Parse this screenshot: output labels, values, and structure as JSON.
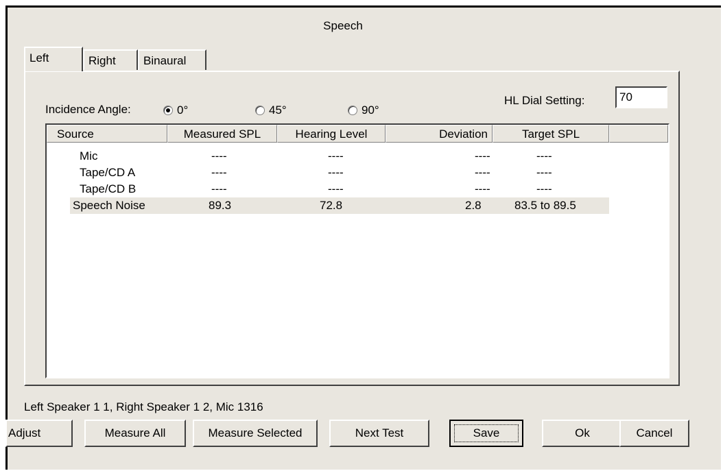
{
  "window": {
    "title": "Speech"
  },
  "tabs": [
    "Left",
    "Right",
    "Binaural"
  ],
  "incidence": {
    "label": "Incidence Angle:",
    "options": [
      "0°",
      "45°",
      "90°"
    ],
    "selected": "0°"
  },
  "hl_dial": {
    "label": "HL Dial Setting:",
    "value": "70"
  },
  "table": {
    "columns": [
      "Source",
      "Measured SPL",
      "Hearing Level",
      "Deviation",
      "Target SPL"
    ],
    "rows": [
      {
        "source": "Mic",
        "measured": "----",
        "hearing": "----",
        "deviation": "----",
        "target": "----"
      },
      {
        "source": "Tape/CD A",
        "measured": "----",
        "hearing": "----",
        "deviation": "----",
        "target": "----"
      },
      {
        "source": "Tape/CD B",
        "measured": "----",
        "hearing": "----",
        "deviation": "----",
        "target": "----"
      },
      {
        "source": "Speech Noise",
        "measured": "89.3",
        "hearing": "72.8",
        "deviation": "2.8",
        "target": "83.5 to 89.5"
      }
    ],
    "selected_row": "Speech Noise"
  },
  "status": "Left Speaker 1 1, Right Speaker 1 2, Mic 1316",
  "buttons": {
    "adjust": "Adjust",
    "measure_all": "Measure All",
    "measure_selected": "Measure Selected",
    "next_test": "Next Test",
    "save": "Save",
    "ok": "Ok",
    "cancel": "Cancel"
  }
}
